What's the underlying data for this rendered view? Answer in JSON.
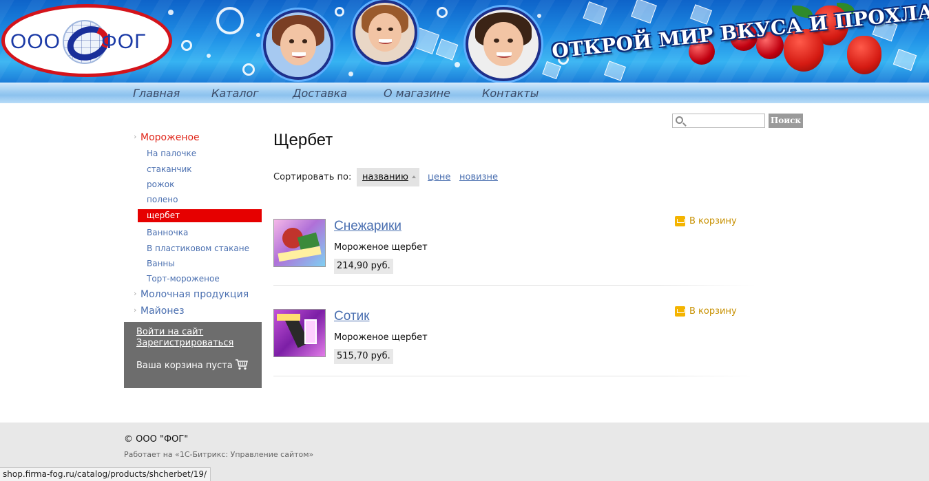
{
  "banner": {
    "logo_left": "ООО",
    "logo_right": "ФОГ",
    "slogan": "ОТКРОЙ МИР ВКУСА И ПРОХЛАДЫ"
  },
  "nav": {
    "items": [
      "Главная",
      "Каталог",
      "Доставка",
      "О магазине",
      "Контакты"
    ]
  },
  "search": {
    "button_label": "Поиск",
    "placeholder": ""
  },
  "sidebar": {
    "categories": [
      {
        "label": "Мороженое",
        "active": true
      },
      {
        "label": "Молочная продукция",
        "active": false
      },
      {
        "label": "Майонез",
        "active": false
      }
    ],
    "subcategories": [
      "На палочке",
      "стаканчик",
      "рожок",
      "полено",
      "щербет",
      "Ванночка",
      "В пластиковом стакане",
      "Ванны",
      "Торт-мороженое"
    ],
    "selected_subcategory": "щербет"
  },
  "auth": {
    "login": "Войти на сайт",
    "register": "Зарегистрироваться",
    "cart_status": "Ваша корзина пуста"
  },
  "main": {
    "title": "Щербет",
    "sort_label": "Сортировать по:",
    "sort_options": [
      "названию",
      "цене",
      "новизне"
    ],
    "sort_active": "названию"
  },
  "products": [
    {
      "name": "Снежарики",
      "description": "Мороженое щербет",
      "price": "214,90 руб.",
      "basket_label": "В корзину"
    },
    {
      "name": "Сотик",
      "description": "Мороженое щербет",
      "price": "515,70 руб.",
      "basket_label": "В корзину"
    }
  ],
  "footer": {
    "copyright": "© ООО \"ФОГ\"",
    "powered": "Работает на «1С-Битрикс: Управление сайтом»"
  },
  "status_url": "shop.firma-fog.ru/catalog/products/shcherbet/19/",
  "colors": {
    "accent_red": "#e60000",
    "link_blue": "#4a6fb0",
    "basket_gold": "#f4b400",
    "sidebar_box": "#6d6d6d"
  },
  "icons": [
    "search-icon",
    "cart-icon",
    "basket-icon",
    "arrow-icon"
  ]
}
